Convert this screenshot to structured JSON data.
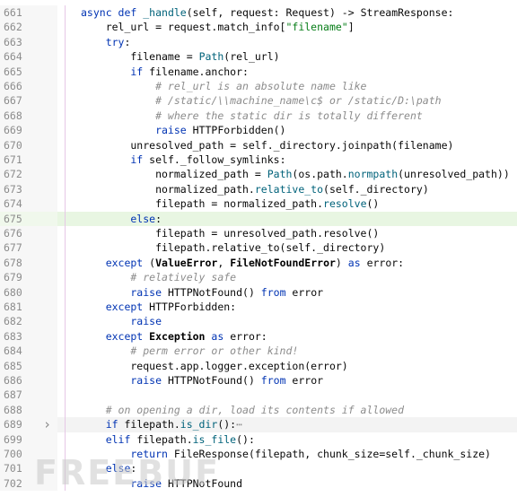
{
  "lines": [
    {
      "num": "661",
      "tokens": [
        [
          "kw",
          "async def "
        ],
        [
          "fn",
          "_handle"
        ],
        [
          "",
          "(self, request: Request) -> StreamResponse:"
        ]
      ]
    },
    {
      "num": "662",
      "tokens": [
        [
          "",
          "    rel_url = request.match_info["
        ],
        [
          "str",
          "\"filename\""
        ],
        [
          "",
          "]"
        ]
      ]
    },
    {
      "num": "663",
      "tokens": [
        [
          "kw",
          "    try"
        ],
        [
          "",
          ":"
        ]
      ]
    },
    {
      "num": "664",
      "tokens": [
        [
          "",
          "        filename = "
        ],
        [
          "call",
          "Path"
        ],
        [
          "",
          "(rel_url)"
        ]
      ]
    },
    {
      "num": "665",
      "tokens": [
        [
          "kw",
          "        if "
        ],
        [
          "",
          "filename.anchor:"
        ]
      ]
    },
    {
      "num": "666",
      "tokens": [
        [
          "cm",
          "            # rel_url is an absolute name like"
        ]
      ]
    },
    {
      "num": "667",
      "tokens": [
        [
          "cm",
          "            # /static/\\\\machine_name\\c$ or /static/D:\\path"
        ]
      ]
    },
    {
      "num": "668",
      "tokens": [
        [
          "cm",
          "            # where the static dir is totally different"
        ]
      ]
    },
    {
      "num": "669",
      "tokens": [
        [
          "kw",
          "            raise "
        ],
        [
          "",
          "HTTPForbidden()"
        ]
      ]
    },
    {
      "num": "670",
      "tokens": [
        [
          "",
          "        unresolved_path = self._directory.joinpath(filename)"
        ]
      ]
    },
    {
      "num": "671",
      "tokens": [
        [
          "kw",
          "        if "
        ],
        [
          "",
          "self._follow_symlinks:"
        ]
      ]
    },
    {
      "num": "672",
      "tokens": [
        [
          "",
          "            normalized_path = "
        ],
        [
          "call",
          "Path"
        ],
        [
          "",
          "(os.path."
        ],
        [
          "call",
          "normpath"
        ],
        [
          "",
          "(unresolved_path))"
        ]
      ]
    },
    {
      "num": "673",
      "tokens": [
        [
          "",
          "            normalized_path."
        ],
        [
          "call",
          "relative_to"
        ],
        [
          "",
          "(self._directory)"
        ]
      ]
    },
    {
      "num": "674",
      "tokens": [
        [
          "",
          "            filepath = normalized_path."
        ],
        [
          "call",
          "resolve"
        ],
        [
          "",
          "()"
        ]
      ]
    },
    {
      "num": "675",
      "tokens": [
        [
          "kw",
          "        else"
        ],
        [
          "",
          ":"
        ]
      ]
    },
    {
      "num": "676",
      "tokens": [
        [
          "",
          "            filepath = unresolved_path.resolve()"
        ]
      ]
    },
    {
      "num": "677",
      "tokens": [
        [
          "",
          "            filepath.relative_to(self._directory)"
        ]
      ]
    },
    {
      "num": "678",
      "tokens": [
        [
          "kw",
          "    except "
        ],
        [
          "",
          "("
        ],
        [
          "exc",
          "ValueError"
        ],
        [
          "",
          ", "
        ],
        [
          "exc",
          "FileNotFoundError"
        ],
        [
          "",
          ") "
        ],
        [
          "kw",
          "as "
        ],
        [
          "",
          "error:"
        ]
      ]
    },
    {
      "num": "679",
      "tokens": [
        [
          "cm",
          "        # relatively safe"
        ]
      ]
    },
    {
      "num": "680",
      "tokens": [
        [
          "kw",
          "        raise "
        ],
        [
          "",
          "HTTPNotFound() "
        ],
        [
          "kw",
          "from "
        ],
        [
          "",
          "error"
        ]
      ]
    },
    {
      "num": "681",
      "tokens": [
        [
          "kw",
          "    except "
        ],
        [
          "",
          "HTTPForbidden:"
        ]
      ]
    },
    {
      "num": "682",
      "tokens": [
        [
          "kw",
          "        raise"
        ]
      ]
    },
    {
      "num": "683",
      "tokens": [
        [
          "kw",
          "    except "
        ],
        [
          "exc",
          "Exception"
        ],
        [
          "kw",
          " as "
        ],
        [
          "",
          "error:"
        ]
      ]
    },
    {
      "num": "684",
      "tokens": [
        [
          "cm",
          "        # perm error or other kind!"
        ]
      ]
    },
    {
      "num": "685",
      "tokens": [
        [
          "",
          "        request.app.logger.exception(error)"
        ]
      ]
    },
    {
      "num": "686",
      "tokens": [
        [
          "kw",
          "        raise "
        ],
        [
          "",
          "HTTPNotFound() "
        ],
        [
          "kw",
          "from "
        ],
        [
          "",
          "error"
        ]
      ]
    },
    {
      "num": "687",
      "tokens": [
        [
          "",
          ""
        ]
      ]
    },
    {
      "num": "688",
      "tokens": [
        [
          "cm",
          "    # on opening a dir, load its contents if allowed"
        ]
      ]
    },
    {
      "num": "689",
      "tokens": [
        [
          "kw",
          "    if "
        ],
        [
          "",
          "filepath."
        ],
        [
          "call",
          "is_dir"
        ],
        [
          "",
          "():"
        ],
        [
          "cm",
          "⋯"
        ]
      ]
    },
    {
      "num": "699",
      "tokens": [
        [
          "kw",
          "    elif "
        ],
        [
          "",
          "filepath."
        ],
        [
          "call",
          "is_file"
        ],
        [
          "",
          "():"
        ]
      ]
    },
    {
      "num": "700",
      "tokens": [
        [
          "kw",
          "        return "
        ],
        [
          "",
          "FileResponse(filepath, chunk_size=self._chunk_size)"
        ]
      ]
    },
    {
      "num": "701",
      "tokens": [
        [
          "kw",
          "    else"
        ],
        [
          "",
          ":"
        ]
      ]
    },
    {
      "num": "702",
      "tokens": [
        [
          "kw",
          "        raise "
        ],
        [
          "",
          "HTTPNotFound"
        ]
      ]
    }
  ],
  "fold_icon": "chevron-right-icon",
  "fold_line": "689",
  "highlight_line": "675",
  "current_line": "689",
  "watermark": "FREEBUF"
}
